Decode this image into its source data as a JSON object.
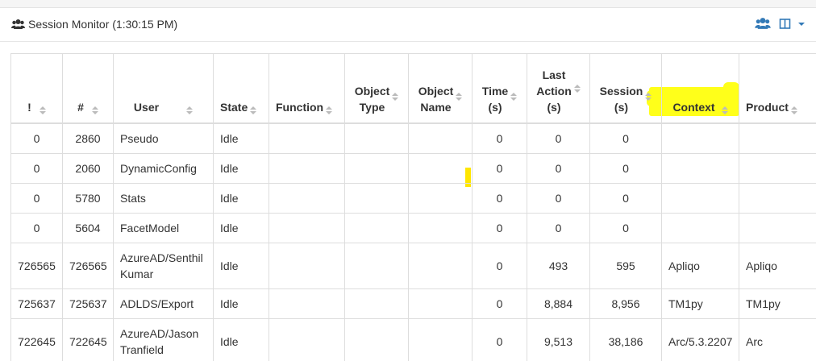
{
  "header": {
    "title": "Session Monitor (1:30:15 PM)",
    "icons": [
      "users-icon",
      "users-icon",
      "columns-icon",
      "caret-down-icon"
    ],
    "accent_color": "#337ab7"
  },
  "table": {
    "columns": [
      {
        "lines": [
          "!"
        ]
      },
      {
        "lines": [
          "#"
        ]
      },
      {
        "lines": [
          "User"
        ]
      },
      {
        "lines": [
          "State"
        ]
      },
      {
        "lines": [
          "Function"
        ]
      },
      {
        "lines": [
          "Object",
          "Type"
        ]
      },
      {
        "lines": [
          "Object",
          "Name"
        ]
      },
      {
        "lines": [
          "Time",
          "(s)"
        ]
      },
      {
        "lines": [
          "Last",
          "Action",
          "(s)"
        ]
      },
      {
        "lines": [
          "Session",
          "(s)"
        ]
      },
      {
        "lines": [
          "Context"
        ]
      },
      {
        "lines": [
          "Product"
        ]
      }
    ],
    "rows": [
      {
        "cells": [
          "0",
          "2860",
          "Pseudo",
          "Idle",
          "",
          "",
          "",
          "0",
          "0",
          "0",
          "",
          ""
        ]
      },
      {
        "cells": [
          "0",
          "2060",
          "DynamicConfig",
          "Idle",
          "",
          "",
          "",
          "0",
          "0",
          "0",
          "",
          ""
        ]
      },
      {
        "cells": [
          "0",
          "5780",
          "Stats",
          "Idle",
          "",
          "",
          "",
          "0",
          "0",
          "0",
          "",
          ""
        ]
      },
      {
        "cells": [
          "0",
          "5604",
          "FacetModel",
          "Idle",
          "",
          "",
          "",
          "0",
          "0",
          "0",
          "",
          ""
        ]
      },
      {
        "cells": [
          "726565",
          "726565",
          "AzureAD/Senthil Kumar",
          "Idle",
          "",
          "",
          "",
          "0",
          "493",
          "595",
          "Apliqo",
          "Apliqo"
        ]
      },
      {
        "cells": [
          "725637",
          "725637",
          "ADLDS/Export",
          "Idle",
          "",
          "",
          "",
          "0",
          "8,884",
          "8,956",
          "TM1py",
          "TM1py"
        ]
      },
      {
        "cells": [
          "722645",
          "722645",
          "AzureAD/Jason Tranfield",
          "Idle",
          "",
          "",
          "",
          "0",
          "9,513",
          "38,186",
          "Arc/5.3.2207",
          "Arc"
        ]
      }
    ]
  },
  "highlight_color": "#ffff1a"
}
